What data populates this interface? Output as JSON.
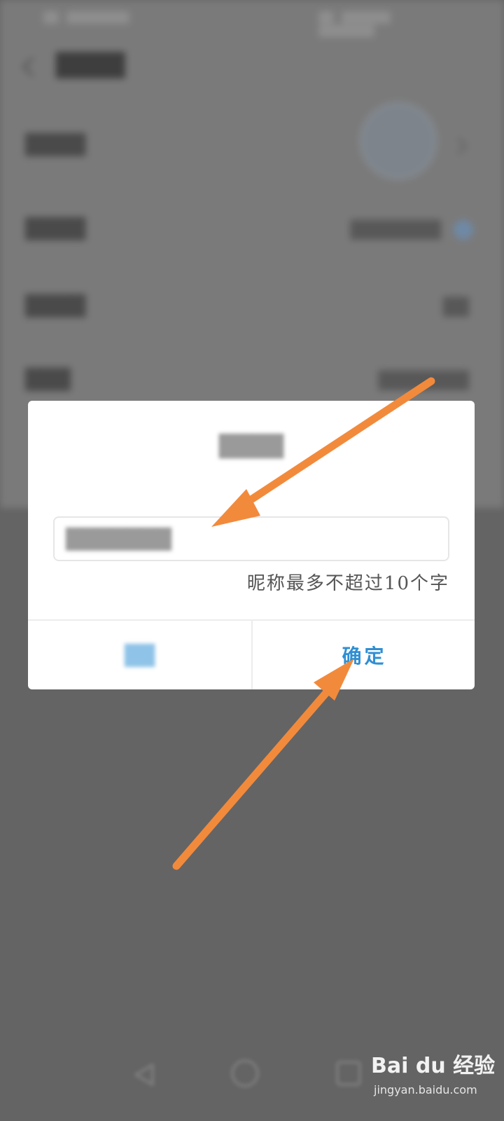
{
  "dialog": {
    "hint": "昵称最多不超过10个字",
    "confirm_label": "确定"
  },
  "watermark": {
    "brand": "Bai du 经验",
    "url": "jingyan.baidu.com"
  },
  "colors": {
    "accent": "#2f8fd3",
    "annotation_arrow": "#f28a3c",
    "overlay": "#646464"
  },
  "icons": {
    "back": "chevron-left-icon",
    "row_arrow": "chevron-right-icon",
    "verified": "verified-badge-icon",
    "nav_back": "triangle-back-icon",
    "nav_home": "circle-home-icon",
    "nav_recent": "square-recent-icon"
  }
}
